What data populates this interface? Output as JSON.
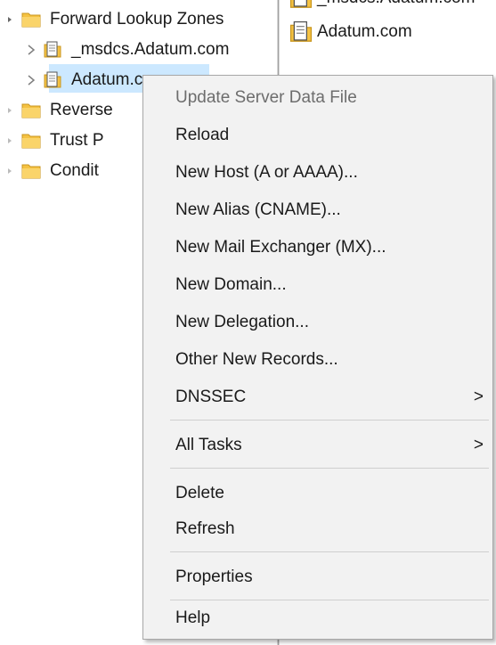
{
  "tree": {
    "items": [
      {
        "label": "Forward Lookup Zones",
        "icon": "folder-icon"
      },
      {
        "label": "_msdcs.Adatum.com",
        "icon": "zone-file-icon"
      },
      {
        "label": "Adatum.com",
        "icon": "zone-file-icon",
        "selected": true
      },
      {
        "label": "Reverse",
        "icon": "folder-icon"
      },
      {
        "label": "Trust P",
        "icon": "folder-icon"
      },
      {
        "label": "Condit",
        "icon": "folder-icon"
      }
    ]
  },
  "right_pane": {
    "items": [
      {
        "label": "_msdcs.Adatum.com",
        "icon": "zone-file-icon"
      },
      {
        "label": "Adatum.com",
        "icon": "zone-file-icon"
      }
    ]
  },
  "context_menu": {
    "items": [
      {
        "label": "Update Server Data File",
        "disabled": true
      },
      {
        "label": "Reload"
      },
      {
        "label": "New Host (A or AAAA)..."
      },
      {
        "label": "New Alias (CNAME)..."
      },
      {
        "label": "New Mail Exchanger (MX)..."
      },
      {
        "label": "New Domain..."
      },
      {
        "label": "New Delegation..."
      },
      {
        "label": "Other New Records..."
      },
      {
        "label": "DNSSEC",
        "submenu_arrow": ">"
      },
      {
        "label": "All Tasks",
        "submenu_arrow": ">"
      },
      {
        "label": "Delete"
      },
      {
        "label": "Refresh"
      },
      {
        "label": "Properties"
      },
      {
        "label": "Help"
      }
    ]
  },
  "colors": {
    "selection": "#cce8ff",
    "menu_background": "#f2f2f2",
    "folder": "#f5c242",
    "disabled_text": "#6d6d6d"
  }
}
